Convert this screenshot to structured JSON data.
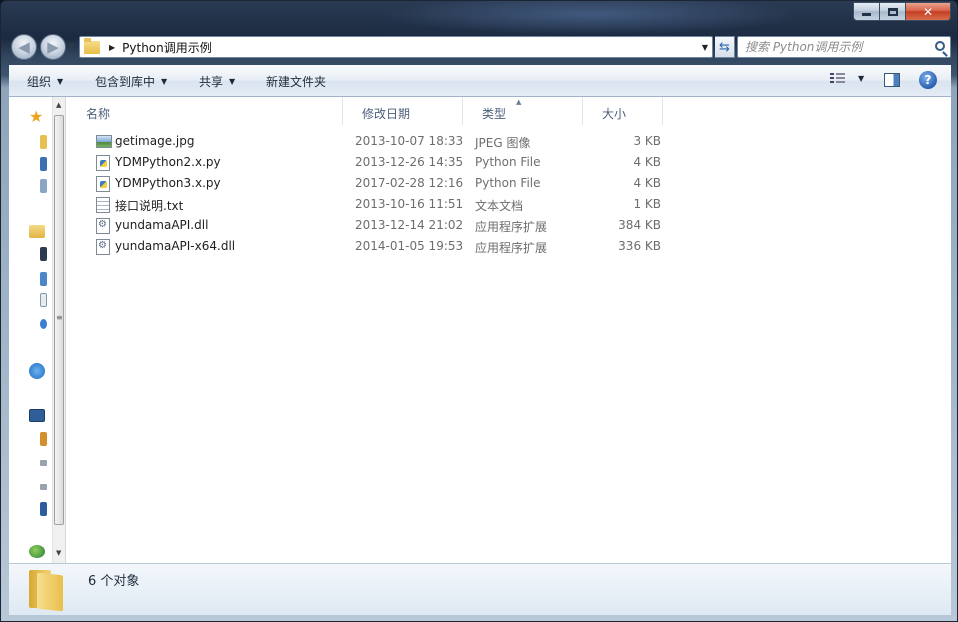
{
  "window": {
    "caption": {
      "minimize": "minimize",
      "maximize": "maximize",
      "close": "close"
    }
  },
  "address": {
    "path": "Python调用示例",
    "search_placeholder": "搜索 Python调用示例"
  },
  "commands": {
    "organize": "组织",
    "include_in_library": "包含到库中",
    "share": "共享",
    "new_folder": "新建文件夹"
  },
  "columns": {
    "name": "名称",
    "date": "修改日期",
    "type": "类型",
    "size": "大小"
  },
  "files": [
    {
      "name": "getimage.jpg",
      "date": "2013-10-07 18:33",
      "type": "JPEG 图像",
      "size": "3 KB",
      "icon": "image-file-icon"
    },
    {
      "name": "YDMPython2.x.py",
      "date": "2013-12-26 14:35",
      "type": "Python File",
      "size": "4 KB",
      "icon": "python-file-icon"
    },
    {
      "name": "YDMPython3.x.py",
      "date": "2017-02-28 12:16",
      "type": "Python File",
      "size": "4 KB",
      "icon": "python-file-icon"
    },
    {
      "name": "接口说明.txt",
      "date": "2013-10-16 11:51",
      "type": "文本文档",
      "size": "1 KB",
      "icon": "text-file-icon"
    },
    {
      "name": "yundamaAPI.dll",
      "date": "2013-12-14 21:02",
      "type": "应用程序扩展",
      "size": "384 KB",
      "icon": "dll-file-icon"
    },
    {
      "name": "yundamaAPI-x64.dll",
      "date": "2014-01-05 19:53",
      "type": "应用程序扩展",
      "size": "336 KB",
      "icon": "dll-file-icon"
    }
  ],
  "details": {
    "count": "6 个对象"
  },
  "colors": {
    "accent": "#2f67b0",
    "command_bar": "#e4ecf5",
    "secondary_text": "#6d6d6d"
  }
}
